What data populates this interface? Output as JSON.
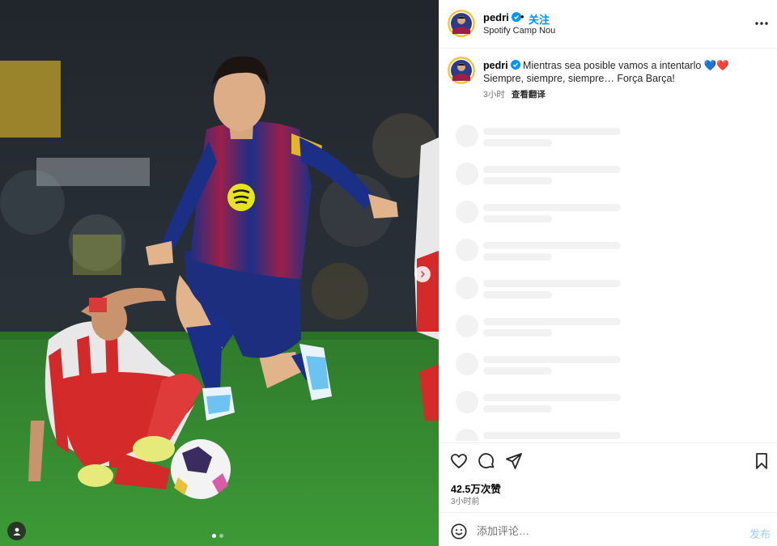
{
  "post": {
    "username": "pedri",
    "follow_label": "关注",
    "separator": "•",
    "location": "Spotify Camp Nou",
    "more_icon": "more-horizontal-icon"
  },
  "caption": {
    "username": "pedri",
    "text_before_emoji": "Mientras sea posible vamos a intentarlo",
    "emojis": [
      "💙",
      "❤️"
    ],
    "text_after_emoji": "Siempre, siempre, siempre… Força Barça!",
    "time": "3小时",
    "translate_label": "查看翻译"
  },
  "comments_loading": 9,
  "actions": {
    "icons": [
      "heart-icon",
      "comment-icon",
      "share-icon",
      "bookmark-icon"
    ],
    "likes": "42.5万次赞",
    "time_ago": "3小时前"
  },
  "comment_box": {
    "placeholder": "添加评论…",
    "post_label": "发布"
  },
  "carousel": {
    "slides": 2,
    "current": 1
  },
  "colors": {
    "accent": "#0095f6",
    "post_disabled": "#9ecff7",
    "secondary_text": "#737373"
  }
}
